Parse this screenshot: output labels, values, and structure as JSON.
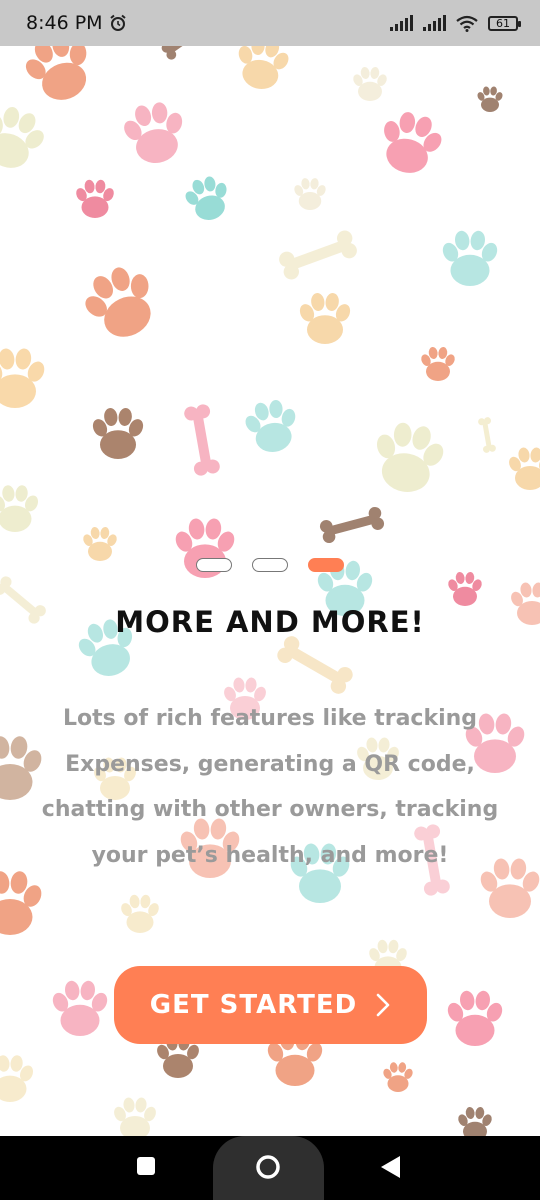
{
  "status_bar": {
    "time": "8:46 PM",
    "alarm_icon": "alarm-clock-icon",
    "battery_level": "61"
  },
  "onboarding": {
    "page_count": 3,
    "active_page": 3,
    "title": "MORE AND MORE!",
    "description": "Lots of rich features like tracking Expenses, generating a QR code, chatting with other owners, tracking your pet’s health, and more!",
    "cta_label": "GET STARTED",
    "cta_icon": "chevron-right-icon"
  },
  "colors": {
    "accent": "#ff7f54",
    "title": "#111111",
    "description": "#9a9a9a",
    "status_bar_bg": "#c8c8c8"
  },
  "nav_bar": {
    "recents_icon": "square-icon",
    "home_icon": "circle-home-icon",
    "back_icon": "triangle-back-icon"
  }
}
